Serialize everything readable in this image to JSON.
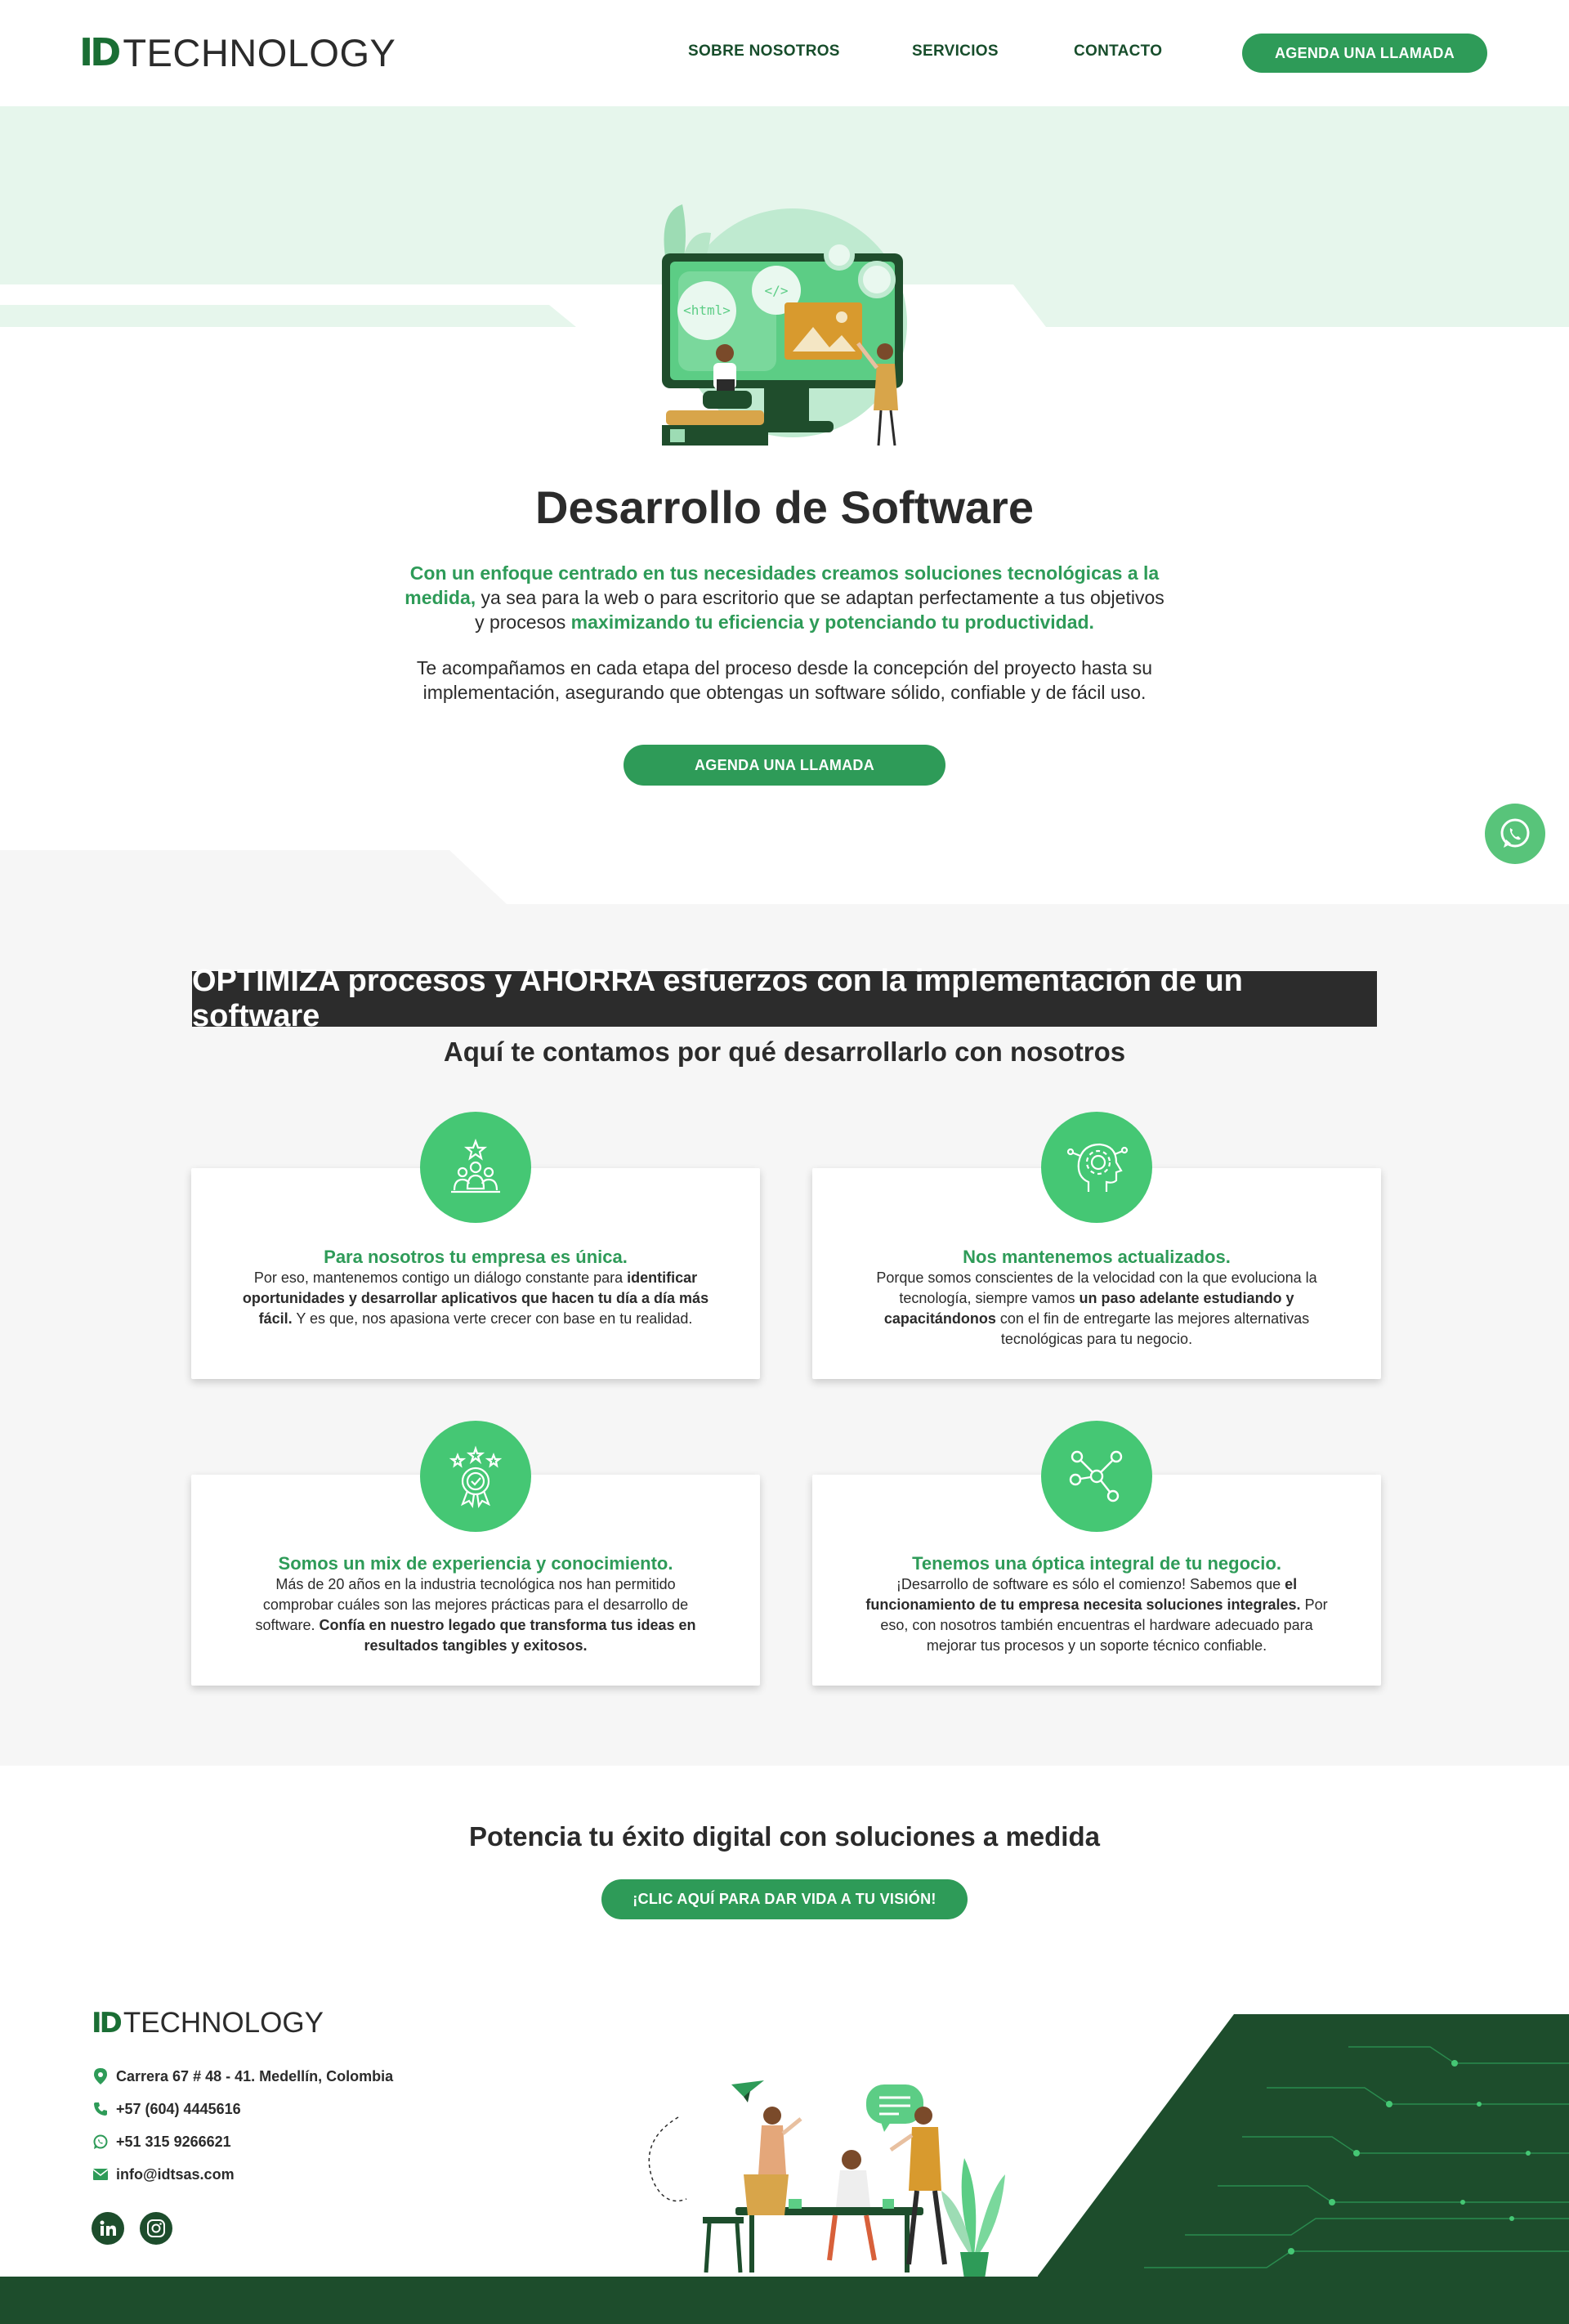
{
  "header": {
    "logo_id": "ID",
    "logo_text": "TECHNOLOGY",
    "nav": [
      "SOBRE NOSOTROS",
      "SERVICIOS",
      "CONTACTO"
    ],
    "cta": "AGENDA UNA LLAMADA"
  },
  "hero": {
    "title": "Desarrollo de Software",
    "p1_green_a": "Con un enfoque centrado en tus necesidades creamos soluciones tecnológicas a la medida,",
    "p1_plain": " ya sea para la web o para escritorio que se adaptan perfectamente a tus objetivos y procesos ",
    "p1_green_b": "maximizando tu eficiencia y potenciando tu productividad.",
    "p2": "Te acompañamos en cada etapa del proceso desde la concepción del proyecto hasta su implementación, asegurando que obtengas un software sólido, confiable y de fácil uso.",
    "cta": "AGENDA UNA LLAMADA",
    "illustration_tags": [
      "<html>",
      "</>"
    ]
  },
  "optimize": {
    "banner": "OPTIMIZA procesos y AHORRA esfuerzos con la implementación de un software",
    "subtitle": "Aquí te contamos por qué desarrollarlo con nosotros",
    "cards": [
      {
        "icon": "team-star-icon",
        "title": "Para nosotros tu empresa es única.",
        "text_a": "Por eso, mantenemos contigo un diálogo constante para ",
        "text_b": "identificar oportunidades y desarrollar aplicativos que hacen tu día a día más fácil.",
        "text_c": " Y es que, nos apasiona verte crecer con base en tu realidad."
      },
      {
        "icon": "head-gear-icon",
        "title": "Nos mantenemos actualizados.",
        "text_a": "Porque somos conscientes de la velocidad con la que evoluciona la tecnología, siempre vamos ",
        "text_b": "un paso adelante estudiando y capacitándonos",
        "text_c": " con el fin de entregarte las mejores alternativas tecnológicas para tu negocio."
      },
      {
        "icon": "award-medal-icon",
        "title": "Somos un mix de experiencia y conocimiento.",
        "text_a": "Más de 20 años en la industria tecnológica nos han permitido comprobar cuáles son las mejores prácticas para el desarrollo de software. ",
        "text_b": "Confía en nuestro legado que transforma tus ideas en resultados tangibles y exitosos.",
        "text_c": ""
      },
      {
        "icon": "network-nodes-icon",
        "title": "Tenemos una óptica integral de tu negocio.",
        "text_a": "¡Desarrollo de software es sólo el comienzo! Sabemos que ",
        "text_b": "el funcionamiento de tu empresa necesita soluciones integrales.",
        "text_c": " Por eso, con nosotros también encuentras el hardware adecuado para mejorar tus procesos y un soporte técnico confiable."
      }
    ]
  },
  "cta_section": {
    "title": "Potencia tu éxito digital con soluciones a medida",
    "button": "¡CLIC AQUÍ PARA DAR VIDA A TU VISIÓN!"
  },
  "footer": {
    "logo_id": "ID",
    "logo_text": "TECHNOLOGY",
    "address": "Carrera 67 # 48 - 41. Medellín, Colombia",
    "phone": "+57 (604) 4445616",
    "whatsapp": "+51 315 9266621",
    "email": "info@idtsas.com",
    "social": [
      "linkedin-icon",
      "instagram-icon"
    ]
  },
  "colors": {
    "brand_green": "#2e9b58",
    "dark_green": "#1d4d2c",
    "icon_green": "#45c774",
    "light_mint": "#e6f6ec",
    "gray_bg": "#f6f6f6",
    "banner_dark": "#2c2c2c"
  }
}
